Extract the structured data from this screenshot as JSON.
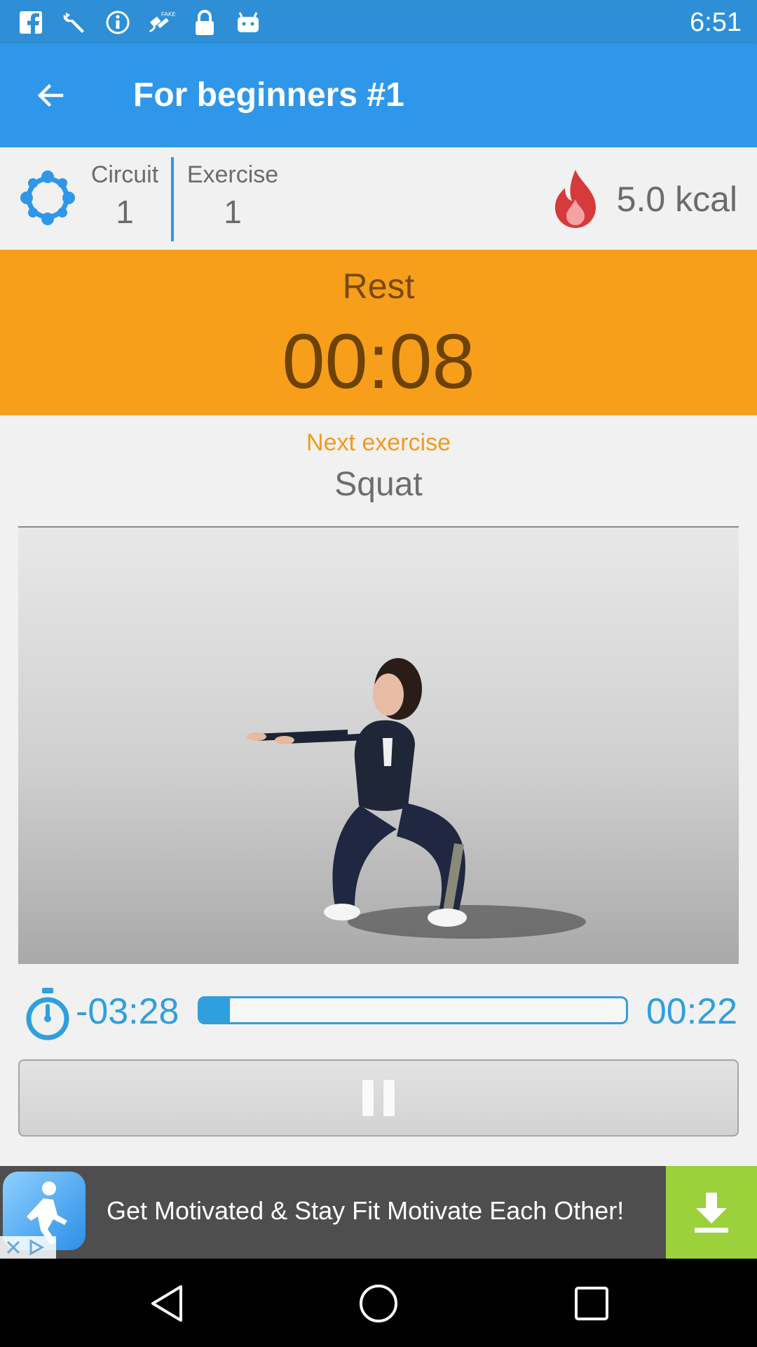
{
  "status_bar": {
    "time": "6:51",
    "icons": [
      "facebook-icon",
      "wrench-icon",
      "info-icon",
      "fake-gps-icon",
      "lock-icon",
      "android-icon"
    ]
  },
  "app_bar": {
    "title": "For beginners #1",
    "back_icon": "arrow-left-icon"
  },
  "info": {
    "circuit_label": "Circuit",
    "circuit_value": "1",
    "exercise_label": "Exercise",
    "exercise_value": "1",
    "calories": "5.0 kcal"
  },
  "rest": {
    "label": "Rest",
    "timer": "00:08"
  },
  "next": {
    "label": "Next exercise",
    "name": "Squat"
  },
  "progress": {
    "elapsed": "-03:28",
    "remaining": "00:22",
    "fraction": 0.07
  },
  "ad": {
    "text": "Get Motivated & Stay Fit Motivate Each Other!"
  },
  "colors": {
    "primary": "#2f97ea",
    "accent": "#f79f1b",
    "progress": "#2f9fde",
    "download": "#9bd13b"
  }
}
